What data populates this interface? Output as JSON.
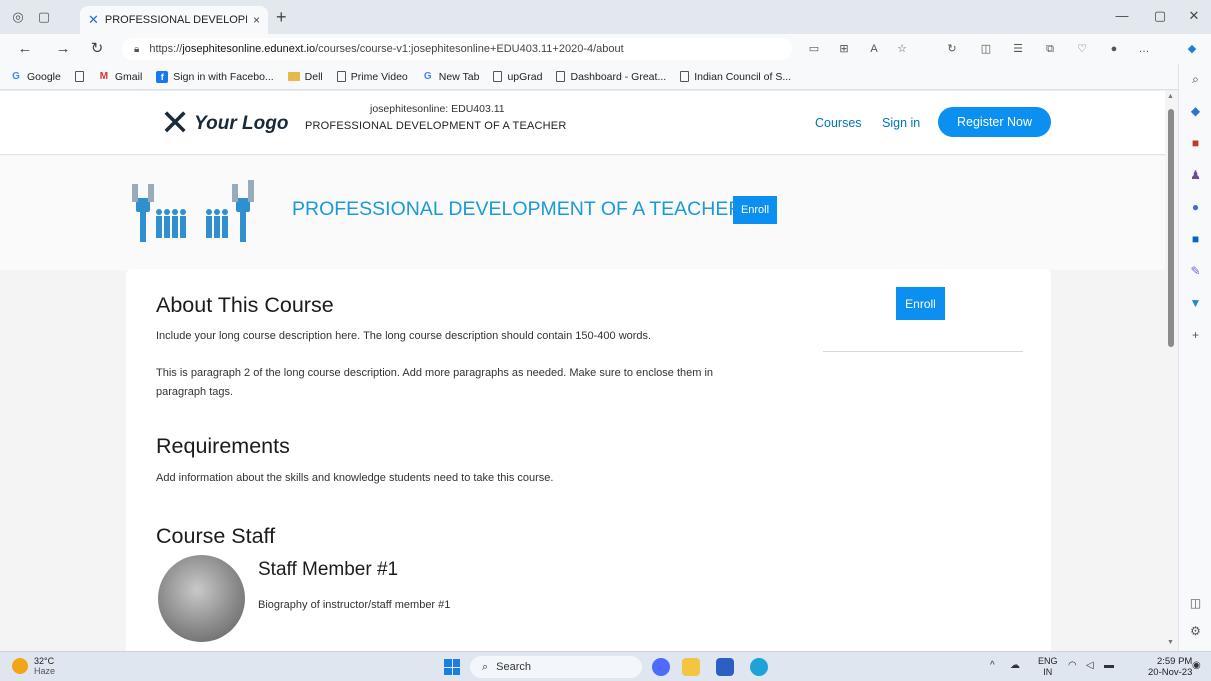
{
  "browser": {
    "tab_title": "PROFESSIONAL DEVELOPMENT C",
    "tab_close": "×",
    "new_tab": "+",
    "url_prefix": "https://",
    "url_domain": "josephitesonline.edunext.io",
    "url_path": "/courses/course-v1:josephitesonline+EDU403.11+2020-4/about",
    "bookmarks": [
      {
        "label": "Google",
        "icon": "google-icon"
      },
      {
        "label": "",
        "icon": "document-icon"
      },
      {
        "label": "Gmail",
        "icon": "gmail-icon"
      },
      {
        "label": "Sign in with Facebo...",
        "icon": "facebook-icon"
      },
      {
        "label": "Dell",
        "icon": "folder-icon"
      },
      {
        "label": "Prime Video",
        "icon": "document-icon"
      },
      {
        "label": "New Tab",
        "icon": "google-icon"
      },
      {
        "label": "upGrad",
        "icon": "document-icon"
      },
      {
        "label": "Dashboard - Great...",
        "icon": "document-icon"
      },
      {
        "label": "Indian Council of S...",
        "icon": "document-icon"
      }
    ]
  },
  "header": {
    "logo_text": "Your Logo",
    "course_org": "josephitesonline: EDU403.11",
    "course_name": "PROFESSIONAL DEVELOPMENT OF A TEACHER",
    "links": [
      "Courses",
      "Sign in"
    ],
    "register_label": "Register Now"
  },
  "hero": {
    "title": "PROFESSIONAL DEVELOPMENT OF A TEACHER",
    "enroll_label": "Enroll"
  },
  "about": {
    "heading": "About This Course",
    "p1": "Include your long course description here. The long course description should contain 150-400 words.",
    "p2_line1": "This is paragraph 2 of the long course description. Add more paragraphs as needed. Make sure to enclose them in",
    "p2_line2": "paragraph tags.",
    "sidebar_enroll_label": "Enroll"
  },
  "requirements": {
    "heading": "Requirements",
    "text": "Add information about the skills and knowledge students need to take this course."
  },
  "staff": {
    "heading": "Course Staff",
    "name": "Staff Member #1",
    "bio": "Biography of instructor/staff member #1"
  },
  "taskbar": {
    "temperature": "32°C",
    "weather": "Haze",
    "search_label": "Search",
    "lang_top": "ENG",
    "lang_bottom": "IN",
    "time": "2:59 PM",
    "date": "20-Nov-23"
  },
  "colors": {
    "accent": "#0b8ff0",
    "hero_title": "#1a9ad6",
    "link": "#0075b4"
  }
}
